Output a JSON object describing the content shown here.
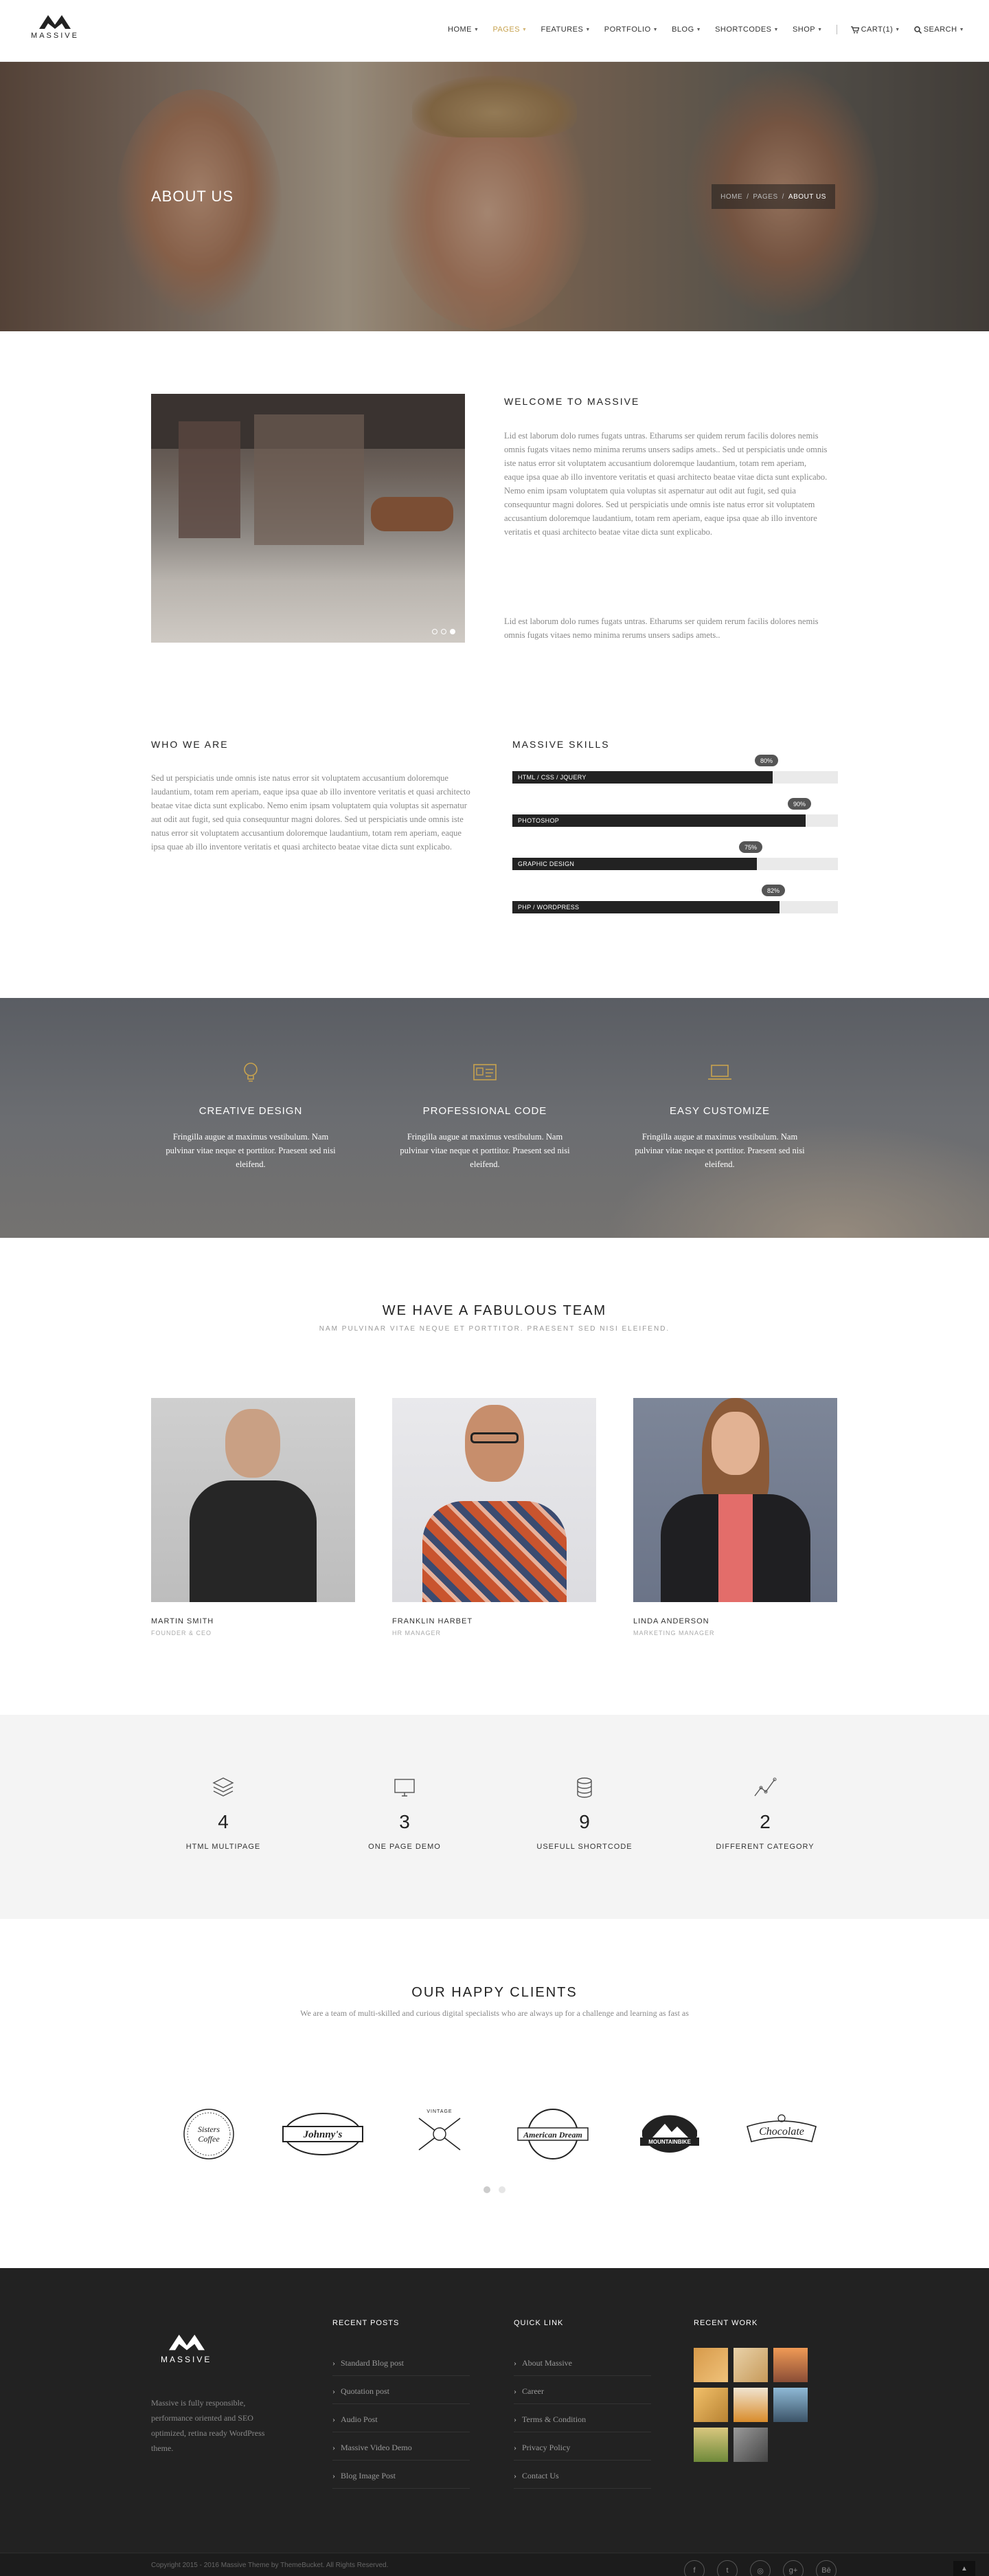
{
  "header": {
    "brand": "MASSIVE",
    "nav": [
      {
        "label": "HOME",
        "active": false,
        "caret": true
      },
      {
        "label": "PAGES",
        "active": true,
        "caret": true
      },
      {
        "label": "FEATURES",
        "active": false,
        "caret": true
      },
      {
        "label": "PORTFOLIO",
        "active": false,
        "caret": true
      },
      {
        "label": "BLOG",
        "active": false,
        "caret": true
      },
      {
        "label": "SHORTCODES",
        "active": false,
        "caret": true
      },
      {
        "label": "SHOP",
        "active": false,
        "caret": true
      }
    ],
    "cart_label": "CART(1)",
    "search_label": "SEARCH"
  },
  "hero": {
    "title": "ABOUT US",
    "breadcrumb": [
      "HOME",
      "PAGES",
      "ABOUT US"
    ]
  },
  "welcome": {
    "heading": "WELCOME TO MASSIVE",
    "para1": "Lid est laborum dolo rumes fugats untras. Etharums ser quidem rerum facilis dolores nemis omnis fugats vitaes nemo minima rerums unsers sadips amets.. Sed ut perspiciatis unde omnis iste natus error sit voluptatem accusantium doloremque laudantium, totam rem aperiam, eaque ipsa quae ab illo inventore veritatis et quasi architecto beatae vitae dicta sunt explicabo. Nemo enim ipsam voluptatem quia voluptas sit aspernatur aut odit aut fugit, sed quia consequuntur magni dolores. Sed ut perspiciatis unde omnis iste natus error sit voluptatem accusantium doloremque laudantium, totam rem aperiam, eaque ipsa quae ab illo inventore veritatis et quasi architecto beatae vitae dicta sunt explicabo.",
    "para2": "Lid est laborum dolo rumes fugats untras. Etharums ser quidem rerum facilis dolores nemis omnis fugats vitaes nemo minima rerums unsers sadips amets.."
  },
  "who": {
    "heading": "WHO WE ARE",
    "text": "Sed ut perspiciatis unde omnis iste natus error sit voluptatem accusantium doloremque laudantium, totam rem aperiam, eaque ipsa quae ab illo inventore veritatis et quasi architecto beatae vitae dicta sunt explicabo. Nemo enim ipsam voluptatem quia voluptas sit aspernatur aut odit aut fugit, sed quia consequuntur magni dolores. Sed ut perspiciatis unde omnis iste natus error sit voluptatem accusantium doloremque laudantium, totam rem aperiam, eaque ipsa quae ab illo inventore veritatis et quasi architecto beatae vitae dicta sunt explicabo."
  },
  "skills": {
    "heading": "MASSIVE SKILLS",
    "items": [
      {
        "label": "HTML / CSS / JQUERY",
        "percent": 80,
        "display": "80%"
      },
      {
        "label": "PHOTOSHOP",
        "percent": 90,
        "display": "90%"
      },
      {
        "label": "GRAPHIC DESIGN",
        "percent": 75,
        "display": "75%"
      },
      {
        "label": "PHP / WORDPRESS",
        "percent": 82,
        "display": "82%"
      }
    ]
  },
  "features": [
    {
      "icon": "lightbulb-icon",
      "title": "CREATIVE DESIGN",
      "desc": "Fringilla augue at maximus vestibulum. Nam pulvinar vitae neque et porttitor. Praesent sed nisi eleifend."
    },
    {
      "icon": "id-card-icon",
      "title": "PROFESSIONAL CODE",
      "desc": "Fringilla augue at maximus vestibulum. Nam pulvinar vitae neque et porttitor. Praesent sed nisi eleifend."
    },
    {
      "icon": "laptop-icon",
      "title": "EASY CUSTOMIZE",
      "desc": "Fringilla augue at maximus vestibulum. Nam pulvinar vitae neque et porttitor. Praesent sed nisi eleifend."
    }
  ],
  "team": {
    "heading": "WE HAVE A FABULOUS TEAM",
    "subheading": "NAM PULVINAR VITAE NEQUE ET PORTTITOR. PRAESENT SED NISI ELEIFEND.",
    "members": [
      {
        "name": "MARTIN SMITH",
        "role": "FOUNDER & CEO"
      },
      {
        "name": "FRANKLIN HARBET",
        "role": "HR MANAGER"
      },
      {
        "name": "LINDA ANDERSON",
        "role": "MARKETING MANAGER"
      }
    ]
  },
  "stats": [
    {
      "icon": "layers-icon",
      "value": "4",
      "label": "HTML MULTIPAGE"
    },
    {
      "icon": "monitor-icon",
      "value": "3",
      "label": "ONE PAGE DEMO"
    },
    {
      "icon": "database-icon",
      "value": "9",
      "label": "USEFULL SHORTCODE"
    },
    {
      "icon": "line-chart-icon",
      "value": "2",
      "label": "DIFFERENT CATEGORY"
    }
  ],
  "clients": {
    "heading": "OUR HAPPY CLIENTS",
    "subheading": "We are a team of multi-skilled and curious digital specialists who are always up for a challenge and learning as fast as",
    "logos": [
      {
        "name": "Sisters Coffee"
      },
      {
        "name": "Johnny's"
      },
      {
        "name": "Vintage"
      },
      {
        "name": "American Dream"
      },
      {
        "name": "MOUNTAINBIKE"
      },
      {
        "name": "Chocolate"
      }
    ]
  },
  "footer": {
    "brand": "MASSIVE",
    "about": "Massive is fully responsible, performance oriented and SEO optimized, retina ready WordPress theme.",
    "recent_posts_title": "RECENT POSTS",
    "recent_posts": [
      "Standard Blog post",
      "Quotation post",
      "Audio Post",
      "Massive Video Demo",
      "Blog Image Post"
    ],
    "quick_link_title": "QUICK LINK",
    "quick_links": [
      "About Massive",
      "Career",
      "Terms & Condition",
      "Privacy Policy",
      "Contact Us"
    ],
    "recent_work_title": "RECENT WORK",
    "copyright": "Copyright 2015 - 2016 Massive Theme by ThemeBucket. All Rights Reserved."
  }
}
